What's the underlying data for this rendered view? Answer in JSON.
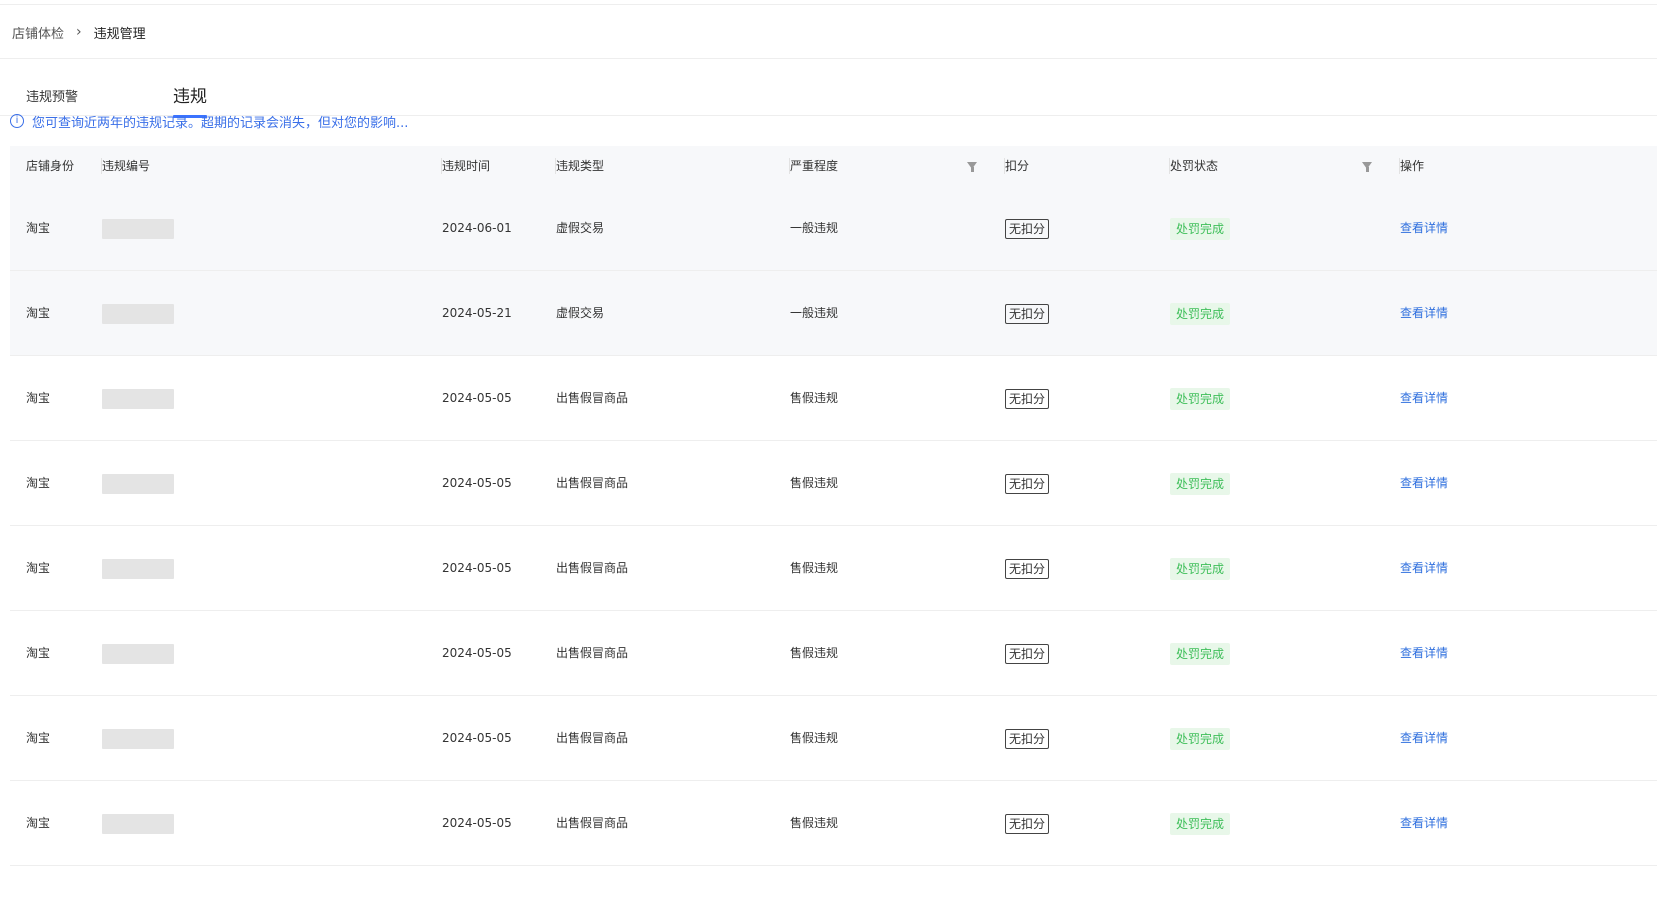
{
  "breadcrumb": {
    "root": "店铺体检",
    "separator": "›",
    "current": "违规管理"
  },
  "tabs": [
    {
      "label": "违规预警",
      "active": false
    },
    {
      "label": "违规",
      "active": true
    }
  ],
  "notice": {
    "icon": "info-icon",
    "text": "您可查询近两年的违规记录。超期的记录会消失，但对您的影响..."
  },
  "table": {
    "headers": {
      "shop": "店铺身份",
      "id": "违规编号",
      "time": "违规时间",
      "type": "违规类型",
      "severity": "严重程度",
      "score": "扣分",
      "status": "处罚状态",
      "op": "操作"
    },
    "rows": [
      {
        "shop": "淘宝",
        "time": "2024-06-01",
        "type": "虚假交易",
        "severity": "一般违规",
        "score": "无扣分",
        "status": "处罚完成",
        "op": "查看详情"
      },
      {
        "shop": "淘宝",
        "time": "2024-05-21",
        "type": "虚假交易",
        "severity": "一般违规",
        "score": "无扣分",
        "status": "处罚完成",
        "op": "查看详情"
      },
      {
        "shop": "淘宝",
        "time": "2024-05-05",
        "type": "出售假冒商品",
        "severity": "售假违规",
        "score": "无扣分",
        "status": "处罚完成",
        "op": "查看详情"
      },
      {
        "shop": "淘宝",
        "time": "2024-05-05",
        "type": "出售假冒商品",
        "severity": "售假违规",
        "score": "无扣分",
        "status": "处罚完成",
        "op": "查看详情"
      },
      {
        "shop": "淘宝",
        "time": "2024-05-05",
        "type": "出售假冒商品",
        "severity": "售假违规",
        "score": "无扣分",
        "status": "处罚完成",
        "op": "查看详情"
      },
      {
        "shop": "淘宝",
        "time": "2024-05-05",
        "type": "出售假冒商品",
        "severity": "售假违规",
        "score": "无扣分",
        "status": "处罚完成",
        "op": "查看详情"
      },
      {
        "shop": "淘宝",
        "time": "2024-05-05",
        "type": "出售假冒商品",
        "severity": "售假违规",
        "score": "无扣分",
        "status": "处罚完成",
        "op": "查看详情"
      },
      {
        "shop": "淘宝",
        "time": "2024-05-05",
        "type": "出售假冒商品",
        "severity": "售假违规",
        "score": "无扣分",
        "status": "处罚完成",
        "op": "查看详情"
      }
    ]
  },
  "colors": {
    "accent": "#3b73ff",
    "link": "#2f6fde",
    "status_text": "#3fbf5a",
    "status_bg": "#e8f7e9"
  }
}
